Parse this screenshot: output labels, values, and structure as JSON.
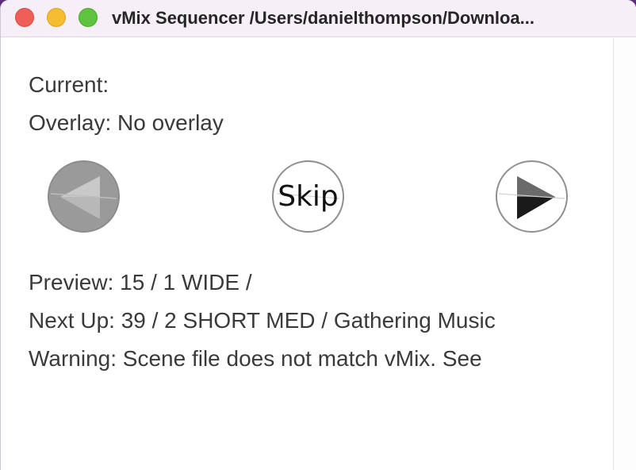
{
  "window": {
    "title": "vMix Sequencer /Users/danielthompson/Downloa..."
  },
  "status": {
    "current": "Current:",
    "overlay": "Overlay: No overlay",
    "preview": "Preview: 15 / 1 WIDE /",
    "next_up": "Next Up: 39 / 2 SHORT MED / Gathering Music",
    "warning": "Warning: Scene file does not match vMix. See"
  },
  "controls": {
    "back_icon": "rewind-triangle-icon",
    "skip_label": "Skip",
    "play_icon": "play-triangle-icon"
  },
  "colors": {
    "close": "#ee5f57",
    "minimize": "#f5bd2f",
    "maximize": "#5ec33e"
  }
}
